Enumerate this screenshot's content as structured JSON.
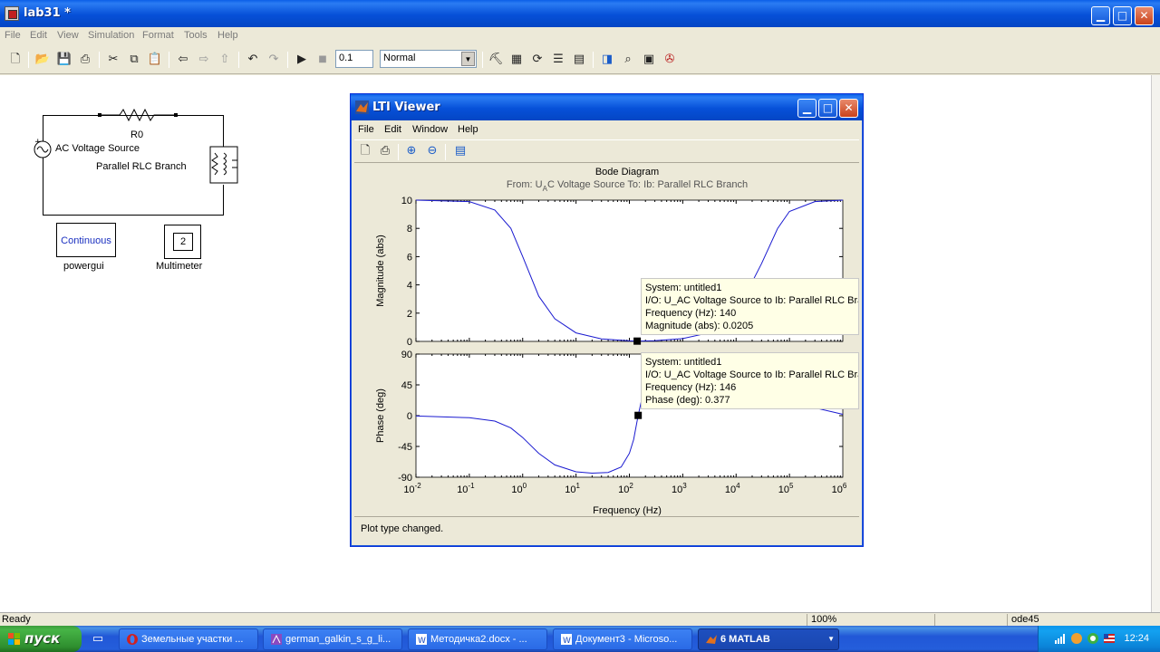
{
  "window": {
    "title": "lab31 *",
    "controls": {
      "minimize": "▁",
      "maximize": "□",
      "close": "✕"
    }
  },
  "menu": [
    "File",
    "Edit",
    "View",
    "Simulation",
    "Format",
    "Tools",
    "Help"
  ],
  "toolbar": {
    "stop_time": "0.1",
    "sim_mode": "Normal"
  },
  "model": {
    "resistor_label": "R0",
    "source_label": "AC Voltage Source",
    "rlc_label": "Parallel RLC Branch",
    "powergui_block_text": "Continuous",
    "powergui_label": "powergui",
    "multimeter_block_text": "2",
    "multimeter_label": "Multimeter"
  },
  "lti": {
    "title": "LTI Viewer",
    "menu": [
      "File",
      "Edit",
      "Window",
      "Help"
    ],
    "status": "Plot type changed.",
    "tip_mag": {
      "system": "System: untitled1",
      "io": "I/O: U_AC Voltage Source to Ib: Parallel RLC Branch",
      "freq": "Frequency (Hz): 140",
      "value": "Magnitude (abs): 0.0205"
    },
    "tip_phase": {
      "system": "System: untitled1",
      "io": "I/O: U_AC Voltage Source to Ib: Parallel RLC Branch",
      "freq": "Frequency (Hz): 146",
      "value": "Phase (deg): 0.377"
    }
  },
  "chart_data": {
    "type": "line",
    "title": "Bode Diagram",
    "subtitle": "From: U_AC Voltage Source  To: Ib: Parallel RLC Branch",
    "xlabel": "Frequency  (Hz)",
    "xscale": "log",
    "xlim": [
      0.01,
      1000000
    ],
    "x_tick_labels": [
      "10^-2",
      "10^-1",
      "10^0",
      "10^1",
      "10^2",
      "10^3",
      "10^4",
      "10^5",
      "10^6"
    ],
    "panels": [
      {
        "ylabel": "Magnitude (abs)",
        "ylim": [
          0,
          10
        ],
        "y_ticks": [
          0,
          2,
          4,
          6,
          8,
          10
        ],
        "series": [
          {
            "x": [
              0.01,
              0.1,
              0.3,
              0.6,
              1,
              2,
              4,
              10,
              30,
              100,
              140,
              300,
              1000,
              3000,
              10000,
              30000,
              60000,
              100000,
              300000,
              1000000
            ],
            "values": [
              10,
              9.9,
              9.3,
              8.0,
              6.0,
              3.2,
              1.6,
              0.6,
              0.18,
              0.04,
              0.0205,
              0.05,
              0.2,
              0.6,
              2.0,
              5.5,
              8.0,
              9.2,
              9.9,
              10
            ]
          }
        ]
      },
      {
        "ylabel": "Phase (deg)",
        "ylim": [
          -90,
          90
        ],
        "y_ticks": [
          -90,
          -45,
          0,
          45,
          90
        ],
        "series": [
          {
            "x": [
              0.01,
              0.1,
              0.3,
              0.6,
              1,
              2,
              4,
              10,
              20,
              40,
              70,
              100,
              120,
              146,
              180,
              250,
              1000,
              10000,
              100000,
              1000000
            ],
            "values": [
              -0.5,
              -3,
              -8,
              -18,
              -32,
              -55,
              -72,
              -82,
              -84,
              -83,
              -75,
              -55,
              -35,
              0.377,
              32,
              60,
              80,
              60,
              20,
              2
            ]
          }
        ]
      }
    ]
  },
  "status": {
    "left": "Ready",
    "zoom": "100%",
    "solver": "ode45"
  },
  "taskbar": {
    "start": "пуск",
    "tasks": [
      "Земельные участки ...",
      "german_galkin_s_g_li...",
      "Методичка2.docx - ...",
      "Документ3 - Microso...",
      "6 MATLAB"
    ],
    "clock": "12:24"
  }
}
